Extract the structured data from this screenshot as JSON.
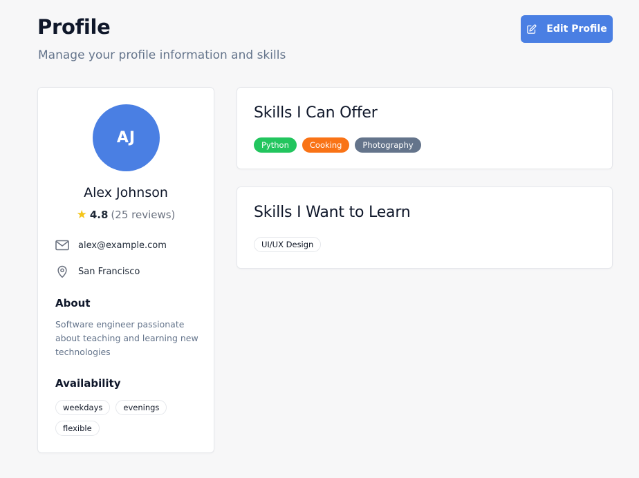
{
  "header": {
    "title": "Profile",
    "subtitle": "Manage your profile information and skills",
    "edit_button_label": "Edit Profile",
    "edit_icon": "pencil-square-icon",
    "accent_color": "#4a7fe3"
  },
  "profile": {
    "initials": "AJ",
    "name": "Alex Johnson",
    "rating": "4.8",
    "reviews": "(25 reviews)",
    "star_icon": "star-icon",
    "email": "alex@example.com",
    "email_icon": "mail-icon",
    "location": "San Francisco",
    "location_icon": "map-pin-icon",
    "about_heading": "About",
    "about_text": "Software engineer passionate about teaching and learning new technologies",
    "availability_heading": "Availability",
    "availability": [
      "weekdays",
      "evenings",
      "flexible"
    ]
  },
  "skills_offer": {
    "title": "Skills I Can Offer",
    "tags": [
      {
        "label": "Python",
        "color": "#22c55e"
      },
      {
        "label": "Cooking",
        "color": "#f97316"
      },
      {
        "label": "Photography",
        "color": "#64748b"
      }
    ]
  },
  "skills_learn": {
    "title": "Skills I Want to Learn",
    "tags": [
      {
        "label": "UI/UX Design"
      }
    ]
  }
}
